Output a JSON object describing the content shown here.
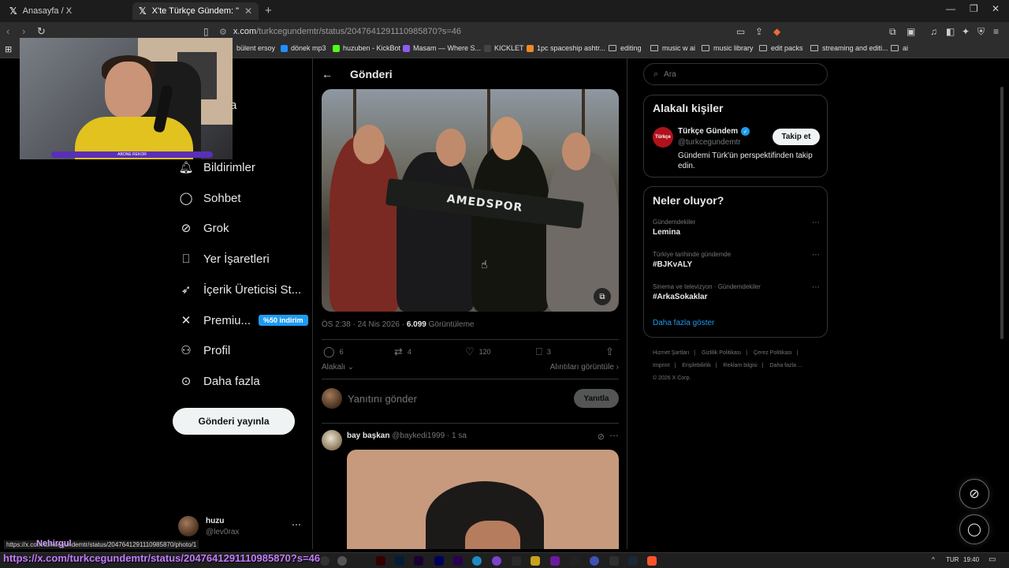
{
  "browser": {
    "tabs": [
      {
        "title": "Anasayfa / X"
      },
      {
        "title": "X'te Türkçe Gündem: \"Kafalar gü"
      }
    ],
    "url_domain": "x.com",
    "url_path": "/turkcegundemtr/status/2047641291110985870?s=46",
    "bookmarks": [
      "bülent ersoy",
      "dönek mp3",
      "huzuben - KickBot",
      "Masam — Where S...",
      "KICKLET",
      "1pc spaceship ashtr...",
      "editing",
      "music w ai",
      "music library",
      "edit packs",
      "streaming and editi...",
      "ai"
    ]
  },
  "webcam": {
    "bar_text": "ABONE REKOR"
  },
  "nav": {
    "items": [
      {
        "label": "Bildirimler",
        "icon": "bell-icon"
      },
      {
        "label": "Sohbet",
        "icon": "chat-icon"
      },
      {
        "label": "Grok",
        "icon": "grok-icon"
      },
      {
        "label": "Yer İşaretleri",
        "icon": "bookmark-icon"
      },
      {
        "label": "İçerik Üreticisi St...",
        "icon": "rocket-icon"
      },
      {
        "label": "Premiu...",
        "icon": "x-icon"
      },
      {
        "label": "Profil",
        "icon": "person-icon"
      },
      {
        "label": "Daha fazla",
        "icon": "more-circle-icon"
      }
    ],
    "partial_home": "ayfa",
    "premium_badge": "%50 indirim",
    "post_button": "Gönderi yayınla"
  },
  "profile": {
    "name": "huzu",
    "handle": "@lev0rax"
  },
  "main": {
    "header_title": "Gönderi",
    "photo_scarf_text": "AMEDSPOR",
    "meta_time": "ÖS 2:38 · 24 Nis 2026 · ",
    "meta_views_count": "6.099",
    "meta_views_label": " Görüntüleme",
    "actions": {
      "replies": "6",
      "reposts": "4",
      "likes": "120",
      "bookmarks": "3"
    },
    "related_left": "Alakalı",
    "related_right": "Alıntıları görüntüle",
    "reply_placeholder": "Yanıtını gönder",
    "reply_button": "Yanıtla",
    "reply_post": {
      "name": "bay başkan",
      "handle": "@baykedi1999",
      "time": "· 1 sa"
    }
  },
  "right": {
    "search_placeholder": "Ara",
    "relevant_title": "Alakalı kişiler",
    "relevant": {
      "name": "Türkçe Gündem",
      "handle": "@turkcegundemtr",
      "bio": "Gündemi Türk'ün perspektifinden takip edin.",
      "follow": "Takip et",
      "logo_text": "Türkçe"
    },
    "trends_title": "Neler oluyor?",
    "trends": [
      {
        "context": "Gündemdekiler",
        "name": "Lemina"
      },
      {
        "context": "Türkiye tarihinde gündemde",
        "name": "#BJKvALY"
      },
      {
        "context": "Sinema ve televizyon · Gündemdekiler",
        "name": "#ArkaSokaklar"
      }
    ],
    "show_more": "Daha fazla göster",
    "footer": [
      "Hizmet Şartları",
      "Gizlilik Politikası",
      "Çerez Politikası",
      "Imprint",
      "Erişilebilirlik",
      "Reklam bilgisi",
      "Daha fazla ...",
      "© 2026 X Corp."
    ]
  },
  "status_bar_url": "https://x.com/turkcegundemtr/status/2047641291110985870/photo/1",
  "overlay": {
    "name": "Nehirgul",
    "big_url": "https://x.com/turkcegundemtr/status/2047641291110985870?s=46"
  },
  "taskbar": {
    "lang": "TUR",
    "time": "19:40"
  }
}
